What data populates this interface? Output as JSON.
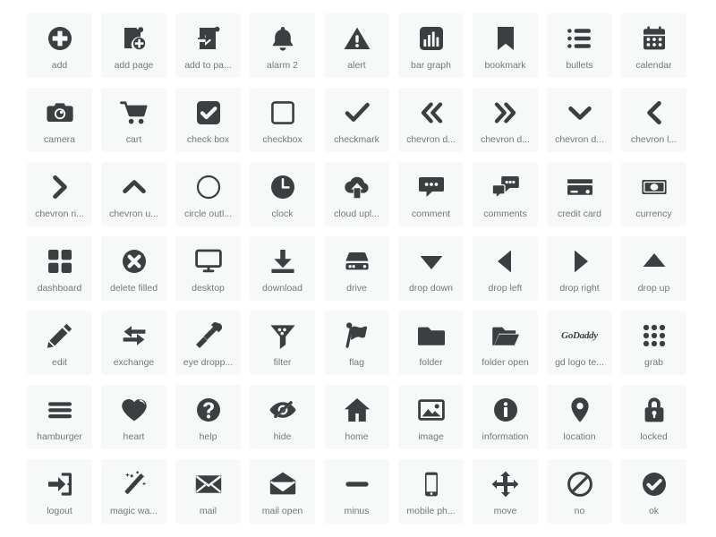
{
  "page": {
    "title": "Icon Library Gallery",
    "background_color": "#ffffff",
    "cell_background_color": "#f7f8f8",
    "icon_color": "#3b3f42",
    "label_color": "#72797f",
    "columns": 9,
    "rows": 7,
    "total_icons": 63
  },
  "icons": [
    {
      "name": "add",
      "label": "add",
      "glyph": "plus-circle-filled-icon"
    },
    {
      "name": "add-page",
      "label": "add page",
      "glyph": "add-page-icon"
    },
    {
      "name": "add-to-page",
      "label": "add to pa...",
      "glyph": "add-to-page-icon"
    },
    {
      "name": "alarm-2",
      "label": "alarm 2",
      "glyph": "bell-icon"
    },
    {
      "name": "alert",
      "label": "alert",
      "glyph": "warning-triangle-icon"
    },
    {
      "name": "bar-graph",
      "label": "bar graph",
      "glyph": "bar-graph-icon"
    },
    {
      "name": "bookmark",
      "label": "bookmark",
      "glyph": "bookmark-icon"
    },
    {
      "name": "bullets",
      "label": "bullets",
      "glyph": "bullet-list-icon"
    },
    {
      "name": "calendar",
      "label": "calendar",
      "glyph": "calendar-icon"
    },
    {
      "name": "camera",
      "label": "camera",
      "glyph": "camera-icon"
    },
    {
      "name": "cart",
      "label": "cart",
      "glyph": "shopping-cart-icon"
    },
    {
      "name": "check-box",
      "label": "check box",
      "glyph": "checkbox-checked-icon"
    },
    {
      "name": "checkbox",
      "label": "checkbox",
      "glyph": "checkbox-empty-icon"
    },
    {
      "name": "checkmark",
      "label": "checkmark",
      "glyph": "checkmark-icon"
    },
    {
      "name": "chevron-double-left",
      "label": "chevron d...",
      "glyph": "chevron-double-left-icon"
    },
    {
      "name": "chevron-double-right",
      "label": "chevron d...",
      "glyph": "chevron-double-right-icon"
    },
    {
      "name": "chevron-down",
      "label": "chevron d...",
      "glyph": "chevron-down-icon"
    },
    {
      "name": "chevron-left",
      "label": "chevron l...",
      "glyph": "chevron-left-icon"
    },
    {
      "name": "chevron-right",
      "label": "chevron ri...",
      "glyph": "chevron-right-icon"
    },
    {
      "name": "chevron-up",
      "label": "chevron u...",
      "glyph": "chevron-up-icon"
    },
    {
      "name": "circle-outline",
      "label": "circle outl...",
      "glyph": "circle-outline-icon"
    },
    {
      "name": "clock",
      "label": "clock",
      "glyph": "clock-icon"
    },
    {
      "name": "cloud-upload",
      "label": "cloud upl...",
      "glyph": "cloud-upload-icon"
    },
    {
      "name": "comment",
      "label": "comment",
      "glyph": "comment-icon"
    },
    {
      "name": "comments",
      "label": "comments",
      "glyph": "comments-icon"
    },
    {
      "name": "credit-card",
      "label": "credit card",
      "glyph": "credit-card-icon"
    },
    {
      "name": "currency",
      "label": "currency",
      "glyph": "currency-icon"
    },
    {
      "name": "dashboard",
      "label": "dashboard",
      "glyph": "dashboard-grid-icon"
    },
    {
      "name": "delete-filled",
      "label": "delete filled",
      "glyph": "delete-filled-icon"
    },
    {
      "name": "desktop",
      "label": "desktop",
      "glyph": "desktop-monitor-icon"
    },
    {
      "name": "download",
      "label": "download",
      "glyph": "download-icon"
    },
    {
      "name": "drive",
      "label": "drive",
      "glyph": "drive-icon"
    },
    {
      "name": "drop-down",
      "label": "drop down",
      "glyph": "triangle-down-icon"
    },
    {
      "name": "drop-left",
      "label": "drop left",
      "glyph": "triangle-left-icon"
    },
    {
      "name": "drop-right",
      "label": "drop right",
      "glyph": "triangle-right-icon"
    },
    {
      "name": "drop-up",
      "label": "drop up",
      "glyph": "triangle-up-icon"
    },
    {
      "name": "edit",
      "label": "edit",
      "glyph": "pencil-icon"
    },
    {
      "name": "exchange",
      "label": "exchange",
      "glyph": "exchange-arrows-icon"
    },
    {
      "name": "eye-dropper",
      "label": "eye dropp...",
      "glyph": "eye-dropper-icon"
    },
    {
      "name": "filter",
      "label": "filter",
      "glyph": "filter-funnel-icon"
    },
    {
      "name": "flag",
      "label": "flag",
      "glyph": "flag-icon"
    },
    {
      "name": "folder",
      "label": "folder",
      "glyph": "folder-icon"
    },
    {
      "name": "folder-open",
      "label": "folder open",
      "glyph": "folder-open-icon"
    },
    {
      "name": "gd-logo-text",
      "label": "gd logo te...",
      "glyph": "godaddy-wordmark-icon",
      "text": "GoDaddy"
    },
    {
      "name": "grab",
      "label": "grab",
      "glyph": "grab-dots-icon"
    },
    {
      "name": "hamburger",
      "label": "hamburger",
      "glyph": "hamburger-menu-icon"
    },
    {
      "name": "heart",
      "label": "heart",
      "glyph": "heart-icon"
    },
    {
      "name": "help",
      "label": "help",
      "glyph": "help-question-icon"
    },
    {
      "name": "hide",
      "label": "hide",
      "glyph": "eye-slash-icon"
    },
    {
      "name": "home",
      "label": "home",
      "glyph": "home-icon"
    },
    {
      "name": "image",
      "label": "image",
      "glyph": "image-picture-icon"
    },
    {
      "name": "information",
      "label": "information",
      "glyph": "info-circle-icon"
    },
    {
      "name": "location",
      "label": "location",
      "glyph": "location-pin-icon"
    },
    {
      "name": "locked",
      "label": "locked",
      "glyph": "lock-closed-icon"
    },
    {
      "name": "logout",
      "label": "logout",
      "glyph": "logout-icon"
    },
    {
      "name": "magic-wand",
      "label": "magic wa...",
      "glyph": "magic-wand-icon"
    },
    {
      "name": "mail",
      "label": "mail",
      "glyph": "mail-envelope-icon"
    },
    {
      "name": "mail-open",
      "label": "mail open",
      "glyph": "mail-open-icon"
    },
    {
      "name": "minus",
      "label": "minus",
      "glyph": "minus-icon"
    },
    {
      "name": "mobile-phone",
      "label": "mobile ph...",
      "glyph": "mobile-phone-icon"
    },
    {
      "name": "move",
      "label": "move",
      "glyph": "move-arrows-icon"
    },
    {
      "name": "no",
      "label": "no",
      "glyph": "no-prohibited-icon"
    },
    {
      "name": "ok",
      "label": "ok",
      "glyph": "ok-check-circle-icon"
    }
  ]
}
